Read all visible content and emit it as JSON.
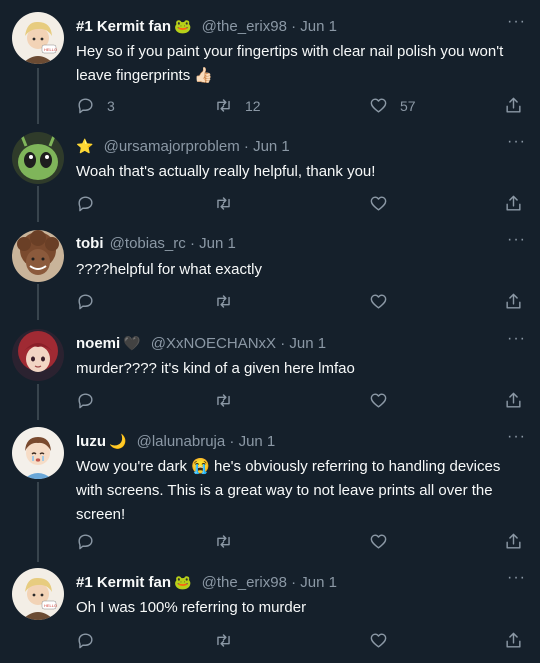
{
  "tweets": [
    {
      "name": "#1 Kermit fan",
      "name_emoji": "🐸",
      "handle": "@the_erix98",
      "date": "Jun 1",
      "text": "Hey so if you paint your fingertips with clear nail polish you won't leave fingerprints 👍🏻",
      "replies": "3",
      "retweets": "12",
      "likes": "57",
      "avatar": "blonde-person-avatar",
      "avatar_bg": "#f3eee6"
    },
    {
      "name": "",
      "name_emoji": "⭐",
      "handle": "@ursamajorproblem",
      "date": "Jun 1",
      "text": "Woah that's actually really helpful, thank you!",
      "replies": "",
      "retweets": "",
      "likes": "",
      "avatar": "green-alien-avatar",
      "avatar_bg": "#6ea64d"
    },
    {
      "name": "tobi",
      "name_emoji": "",
      "handle": "@tobias_rc",
      "date": "Jun 1",
      "text": "????helpful for what exactly",
      "replies": "",
      "retweets": "",
      "likes": "",
      "avatar": "curly-hair-avatar",
      "avatar_bg": "#8a5b3e"
    },
    {
      "name": "noemi",
      "name_emoji": "🖤",
      "handle": "@XxNOECHANxX",
      "date": "Jun 1",
      "text": "murder???? it's kind of a given here lmfao",
      "replies": "",
      "retweets": "",
      "likes": "",
      "avatar": "red-hair-avatar",
      "avatar_bg": "#2b2230"
    },
    {
      "name": "luzu",
      "name_emoji": "🌙",
      "handle": "@lalunabruja",
      "date": "Jun 1",
      "text": "Wow you're dark 😭 he's obviously referring to handling devices with screens. This is a great way to not leave prints all over the screen!",
      "replies": "",
      "retweets": "",
      "likes": "",
      "avatar": "crying-kid-avatar",
      "avatar_bg": "#f4f0ea"
    },
    {
      "name": "#1 Kermit fan",
      "name_emoji": "🐸",
      "handle": "@the_erix98",
      "date": "Jun 1",
      "text": "Oh I was 100% referring to murder",
      "replies": "",
      "retweets": "",
      "likes": "",
      "avatar": "blonde-person-avatar",
      "avatar_bg": "#f3eee6"
    }
  ],
  "separator": "·",
  "colors": {
    "background": "#15202b",
    "text": "#f7f9f9",
    "muted": "#8b98a5",
    "thread_line": "#38444d"
  }
}
